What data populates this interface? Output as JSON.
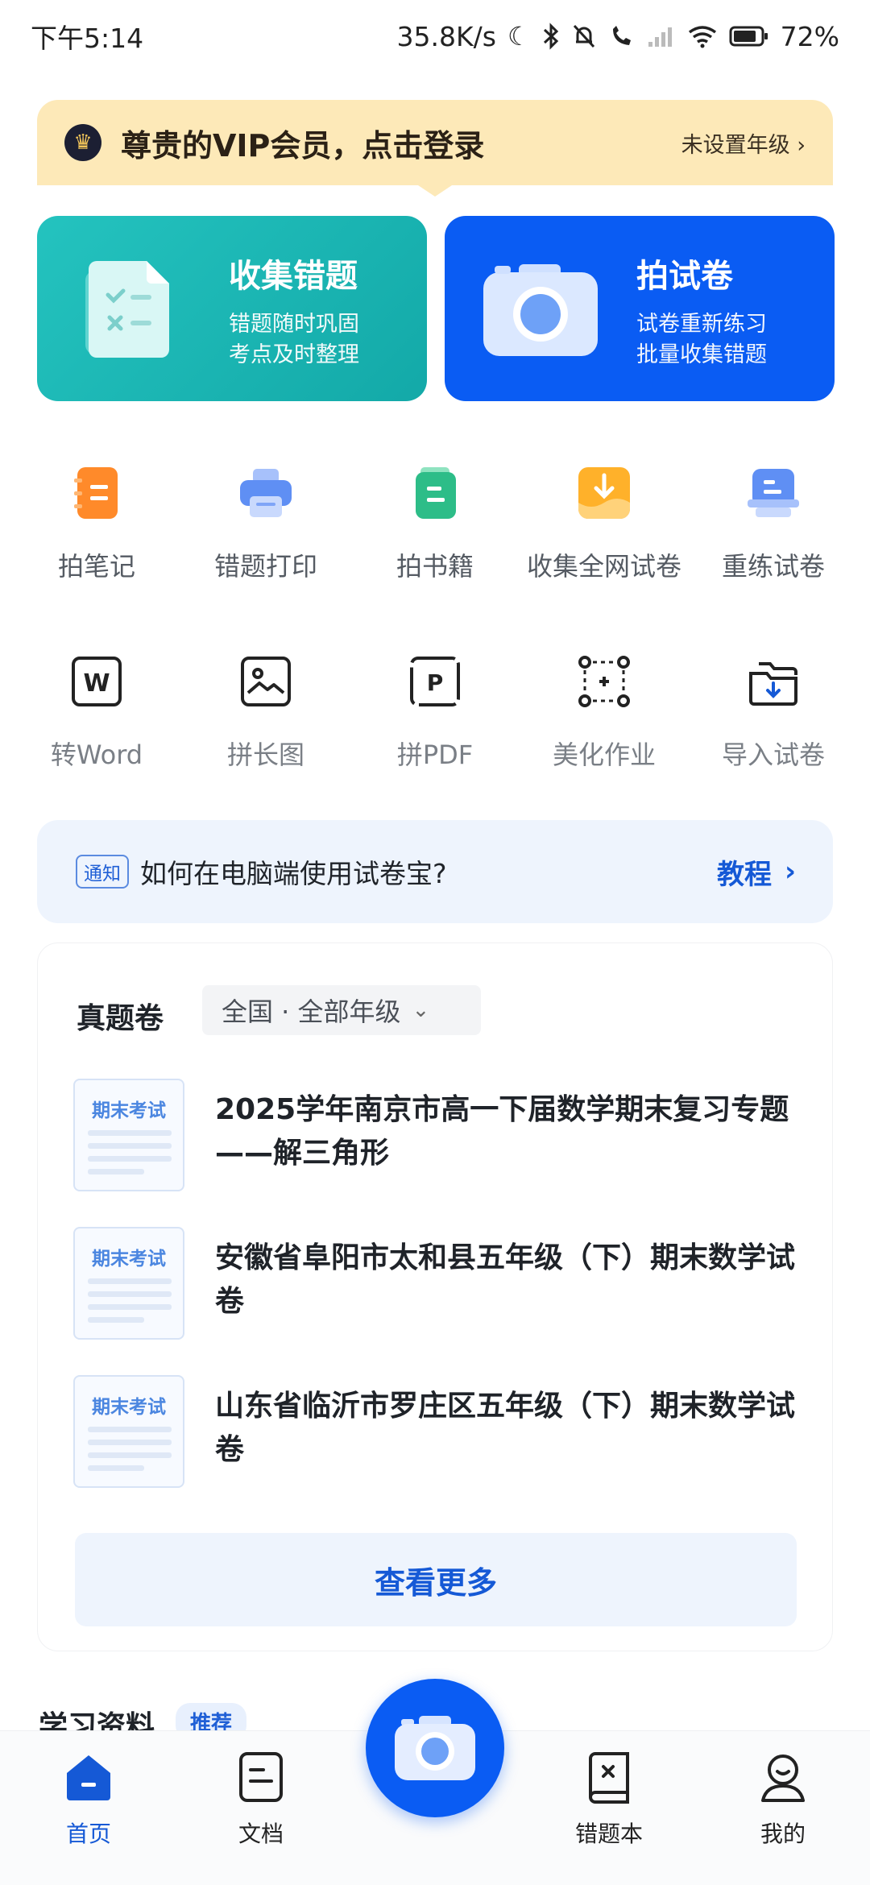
{
  "status_bar": {
    "time": "下午5:14",
    "net_speed": "35.8K/s",
    "battery": "72%"
  },
  "vip": {
    "text": "尊贵的VIP会员，点击登录",
    "grade": "未设置年级 ›"
  },
  "cards": [
    {
      "title": "收集错题",
      "line1": "错题随时巩固",
      "line2": "考点及时整理",
      "color": "#1bb6b4"
    },
    {
      "title": "拍试卷",
      "line1": "试卷重新练习",
      "line2": "批量收集错题",
      "color": "#0a5cf3"
    }
  ],
  "tools_row1": [
    {
      "label": "拍笔记",
      "icon": "notebook-icon"
    },
    {
      "label": "错题打印",
      "icon": "printer-icon"
    },
    {
      "label": "拍书籍",
      "icon": "book-icon"
    },
    {
      "label": "收集全网试卷",
      "icon": "download-tray-icon"
    },
    {
      "label": "重练试卷",
      "icon": "paper-stack-icon"
    }
  ],
  "tools_row2": [
    {
      "label": "转Word",
      "icon": "word-icon"
    },
    {
      "label": "拼长图",
      "icon": "long-image-icon"
    },
    {
      "label": "拼PDF",
      "icon": "pdf-icon"
    },
    {
      "label": "美化作业",
      "icon": "beautify-icon"
    },
    {
      "label": "导入试卷",
      "icon": "import-folder-icon"
    }
  ],
  "notice": {
    "tag": "通知",
    "text": "如何在电脑端使用试卷宝?",
    "link": "教程"
  },
  "exam": {
    "title": "真题卷",
    "region": "全国 · 全部年级",
    "thumb_label": "期末考试",
    "papers": [
      {
        "title": "2025学年南京市高一下届数学期末复习专题——解三角形"
      },
      {
        "title": "安徽省阜阳市太和县五年级（下）期末数学试卷"
      },
      {
        "title": "山东省临沂市罗庄区五年级（下）期末数学试卷"
      }
    ],
    "more": "查看更多"
  },
  "study": {
    "title": "学习资料",
    "tag": "推荐"
  },
  "tabs": [
    {
      "label": "首页",
      "active": true
    },
    {
      "label": "文档"
    },
    {
      "label": "错题本"
    },
    {
      "label": "我的"
    }
  ],
  "colors": {
    "accent": "#0a5cf3",
    "teal": "#1bb6b4",
    "vip_bg": "#fde9b8"
  }
}
